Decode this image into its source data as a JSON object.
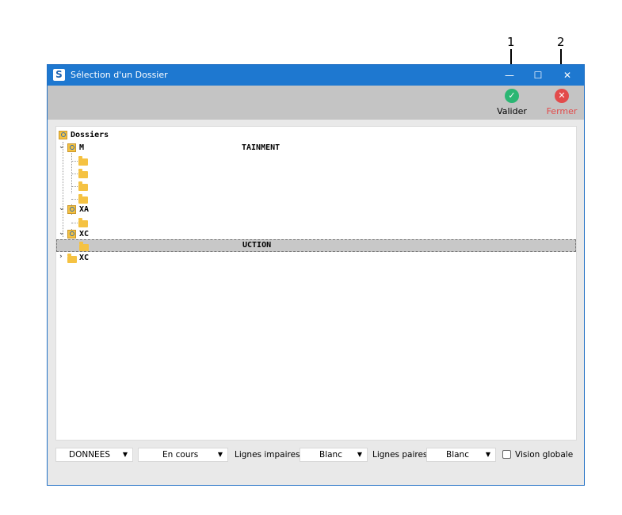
{
  "annotations": {
    "one": "1",
    "two": "2"
  },
  "window": {
    "app_icon": "S",
    "title": "Sélection d'un Dossier",
    "minimize": "—",
    "maximize": "☐",
    "close": "✕"
  },
  "toolbar": {
    "validate_label": "Valider",
    "close_label": "Fermer",
    "validate_color": "#2bb673",
    "close_color": "#e24b4b",
    "close_text_color": "#e24b4b"
  },
  "tree": {
    "root": "Dossiers",
    "nodes": [
      {
        "label": "M",
        "suffix": "TAINMENT"
      },
      {
        "label": "XA"
      },
      {
        "label": "XC",
        "suffix": "UCTION"
      },
      {
        "label": "XC"
      }
    ]
  },
  "bottom": {
    "donnees": "DONNEES",
    "status": "En cours",
    "odd_rows_label": "Lignes impaires",
    "odd_rows_value": "Blanc",
    "even_rows_label": "Lignes paires",
    "even_rows_value": "Blanc",
    "global_view_label": "Vision globale",
    "dropdown_arrow": "▼"
  }
}
